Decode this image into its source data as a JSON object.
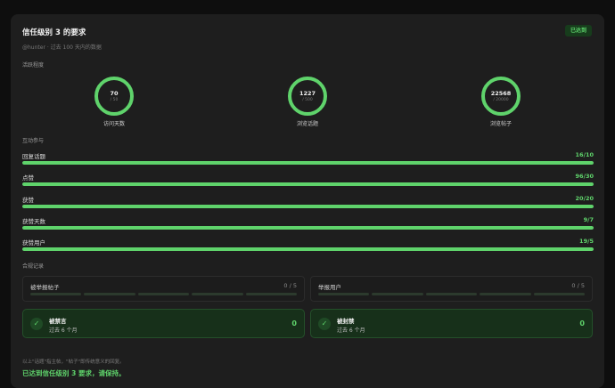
{
  "header": {
    "title": "信任级别 3 的要求",
    "subtitle": "@hunter · 过去 100 天内的数据",
    "badge": "已达到"
  },
  "activity": {
    "label": "活跃程度",
    "gauges": [
      {
        "value": "70",
        "target": "/ 50",
        "label": "访问天数",
        "progress": 1.0
      },
      {
        "value": "1227",
        "target": "/ 500",
        "label": "浏览话题",
        "progress": 1.0
      },
      {
        "value": "22568",
        "target": "/ 20000",
        "label": "浏览帖子",
        "progress": 1.0
      }
    ]
  },
  "interaction": {
    "label": "互动参与",
    "bars": [
      {
        "name": "回复话题",
        "value": "16/10",
        "progress": 1.0
      },
      {
        "name": "点赞",
        "value": "96/30",
        "progress": 1.0
      },
      {
        "name": "获赞",
        "value": "20/20",
        "progress": 1.0
      },
      {
        "name": "获赞天数",
        "value": "9/7",
        "progress": 1.0
      },
      {
        "name": "获赞用户",
        "value": "19/5",
        "progress": 1.0
      }
    ]
  },
  "compliance": {
    "label": "合规记录",
    "items": [
      {
        "name": "被举报帖子",
        "value": "0 / 5",
        "segments": 5
      },
      {
        "name": "举报用户",
        "value": "0 / 5",
        "segments": 5
      }
    ],
    "status": [
      {
        "title": "被禁言",
        "sub": "过去 6 个月",
        "value": "0"
      },
      {
        "title": "被封禁",
        "sub": "过去 6 个月",
        "value": "0"
      }
    ]
  },
  "footer": {
    "note": "以上\"话题\"指主帖，\"帖子\"即传统意义的回复。",
    "ok": "已达到信任级别 3 要求，请保持。"
  },
  "colors": {
    "accent": "#5fd36b",
    "card": "#1e1e1e",
    "background": "#0e0e0e"
  }
}
